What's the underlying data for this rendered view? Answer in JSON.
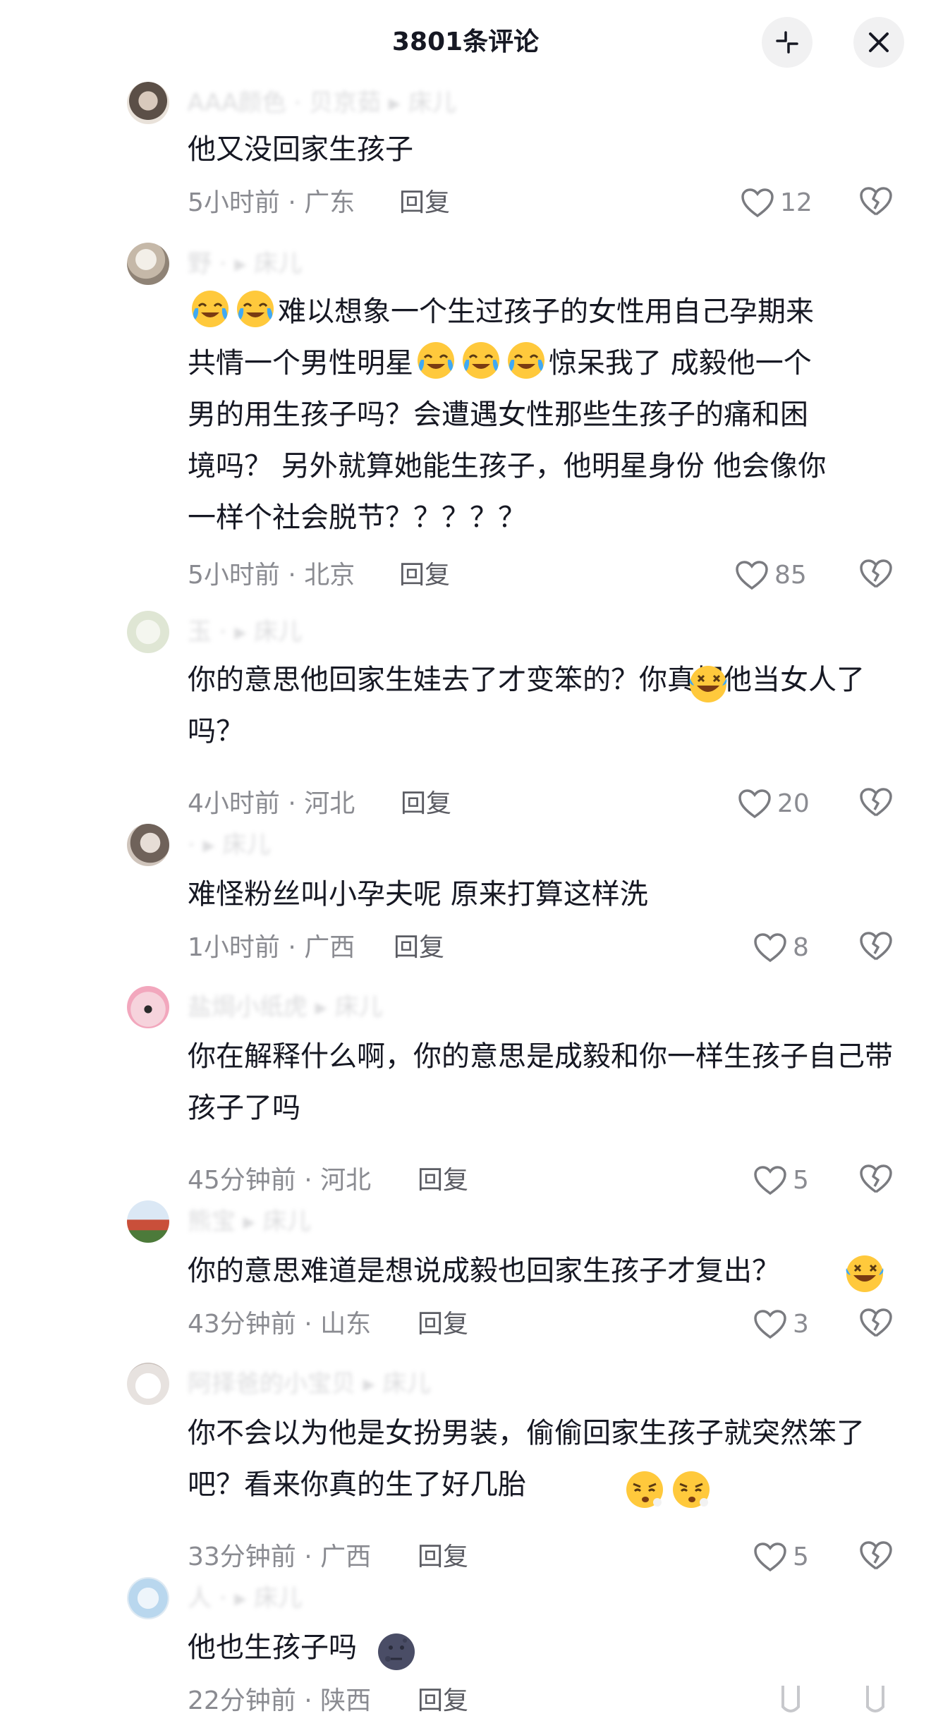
{
  "header": {
    "title": "3801条评论",
    "collapse_icon": "collapse-icon",
    "close_icon": "close-icon"
  },
  "ui": {
    "reply_label": "回复",
    "accent": "#161823",
    "muted": "#8a8b91"
  },
  "comments": [
    {
      "username": "AAA颜色 · 贝京茹 ▸ 床儿",
      "content": "他又没回家生孩子",
      "time": "5小时前 · 广东",
      "likes": "12"
    },
    {
      "username": "野 · ▸ 床儿",
      "content": "难以想象一个生过孩子的女性用自己孕期来共情一个男性明星惊呆我了  成毅他一个男的用生孩子吗？会遭遇女性那些生孩子的痛和困境吗？  另外就算她能生孩子，他明星身份 他会像你一样个社会脱节？？？？？",
      "content_parts": [
        "",
        "难以想象一个生过孩子的女性用自己孕期来",
        "共情一个男性明星",
        "惊呆我了  成毅他一个",
        "男的用生孩子吗？会遭遇女性那些生孩子的痛和困",
        "境吗？  另外就算她能生孩子，他明星身份 他会像你",
        "一样个社会脱节？？？？？"
      ],
      "time": "5小时前 · 北京",
      "likes": "85"
    },
    {
      "username": "玉 · ▸ 床儿",
      "content": "你的意思他回家生娃去了才变笨的？你真把他当女人了吗？",
      "time": "4小时前 · 河北",
      "likes": "20"
    },
    {
      "username": "· ▸ 床儿",
      "content": "难怪粉丝叫小孕夫呢 原来打算这样洗",
      "time": "1小时前 · 广西",
      "likes": "8"
    },
    {
      "username": "盐焗小纸虎 ▸ 床儿",
      "content": "你在解释什么啊，你的意思是成毅和你一样生孩子自己带孩子了吗",
      "time": "45分钟前 · 河北",
      "likes": "5"
    },
    {
      "username": "熊宝 ▸ 床儿",
      "content": "你的意思难道是想说成毅也回家生孩子才复出？",
      "time": "43分钟前 · 山东",
      "likes": "3"
    },
    {
      "username": "阿择爸的小宝贝 ▸ 床儿",
      "content": "你不会以为他是女扮男装，偷偷回家生孩子就突然笨了吧？看来你真的生了好几胎",
      "time": "33分钟前 · 广西",
      "likes": "5"
    },
    {
      "username": "人 · ▸ 床儿",
      "content": "他也生孩子吗",
      "time": "22分钟前 · 陕西",
      "likes": ""
    }
  ],
  "emoji_names": [
    "crying-laughing-emoji",
    "rolling-laughing-emoji",
    "pouting-emoji",
    "dark-moon-emoji"
  ]
}
